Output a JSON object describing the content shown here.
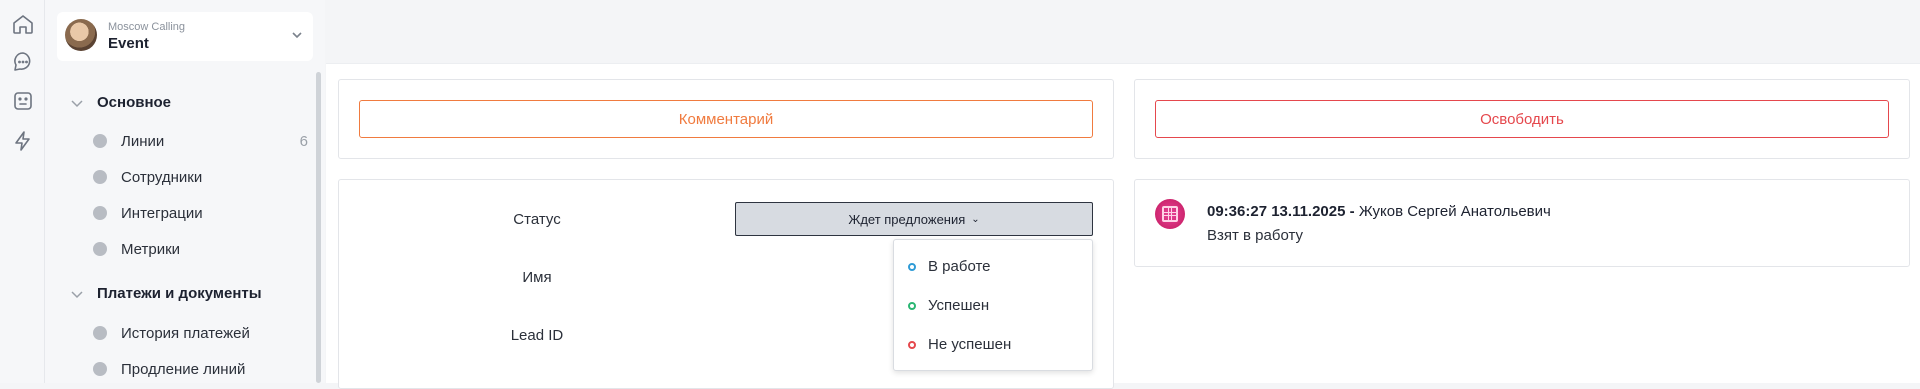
{
  "rail": {
    "icons": [
      "home-icon",
      "chat-icon",
      "bot-icon",
      "lightning-icon"
    ]
  },
  "project": {
    "subtitle": "Moscow Calling",
    "title": "Event"
  },
  "sidebar": {
    "sections": [
      {
        "label": "Основное",
        "items": [
          {
            "label": "Линии",
            "count": "6",
            "icon": "lines-icon"
          },
          {
            "label": "Сотрудники",
            "icon": "users-icon"
          },
          {
            "label": "Интеграции",
            "icon": "integrations-icon"
          },
          {
            "label": "Метрики",
            "icon": "metrics-icon"
          }
        ]
      },
      {
        "label": "Платежи и документы",
        "items": [
          {
            "label": "История платежей",
            "icon": "history-icon"
          },
          {
            "label": "Продление линий",
            "icon": "renew-icon"
          }
        ]
      }
    ]
  },
  "actions": {
    "comment_label": "Комментарий",
    "release_label": "Освободить"
  },
  "form": {
    "status_label": "Статус",
    "name_label": "Имя",
    "lead_label": "Lead ID",
    "status_value": "Ждет предложения",
    "status_options": [
      {
        "label": "В работе",
        "color": "#2f9bd6"
      },
      {
        "label": "Успешен",
        "color": "#2bb673"
      },
      {
        "label": "Не успешен",
        "color": "#e5484d"
      }
    ]
  },
  "log": {
    "timestamp": "09:36:27 13.11.2025",
    "separator": " - ",
    "author": "Жуков Сергей Анатольевич",
    "text": "Взят в работу"
  },
  "colors": {
    "comment_accent": "#f07b3f",
    "release_accent": "#e5484d",
    "log_icon": "#d63384"
  }
}
